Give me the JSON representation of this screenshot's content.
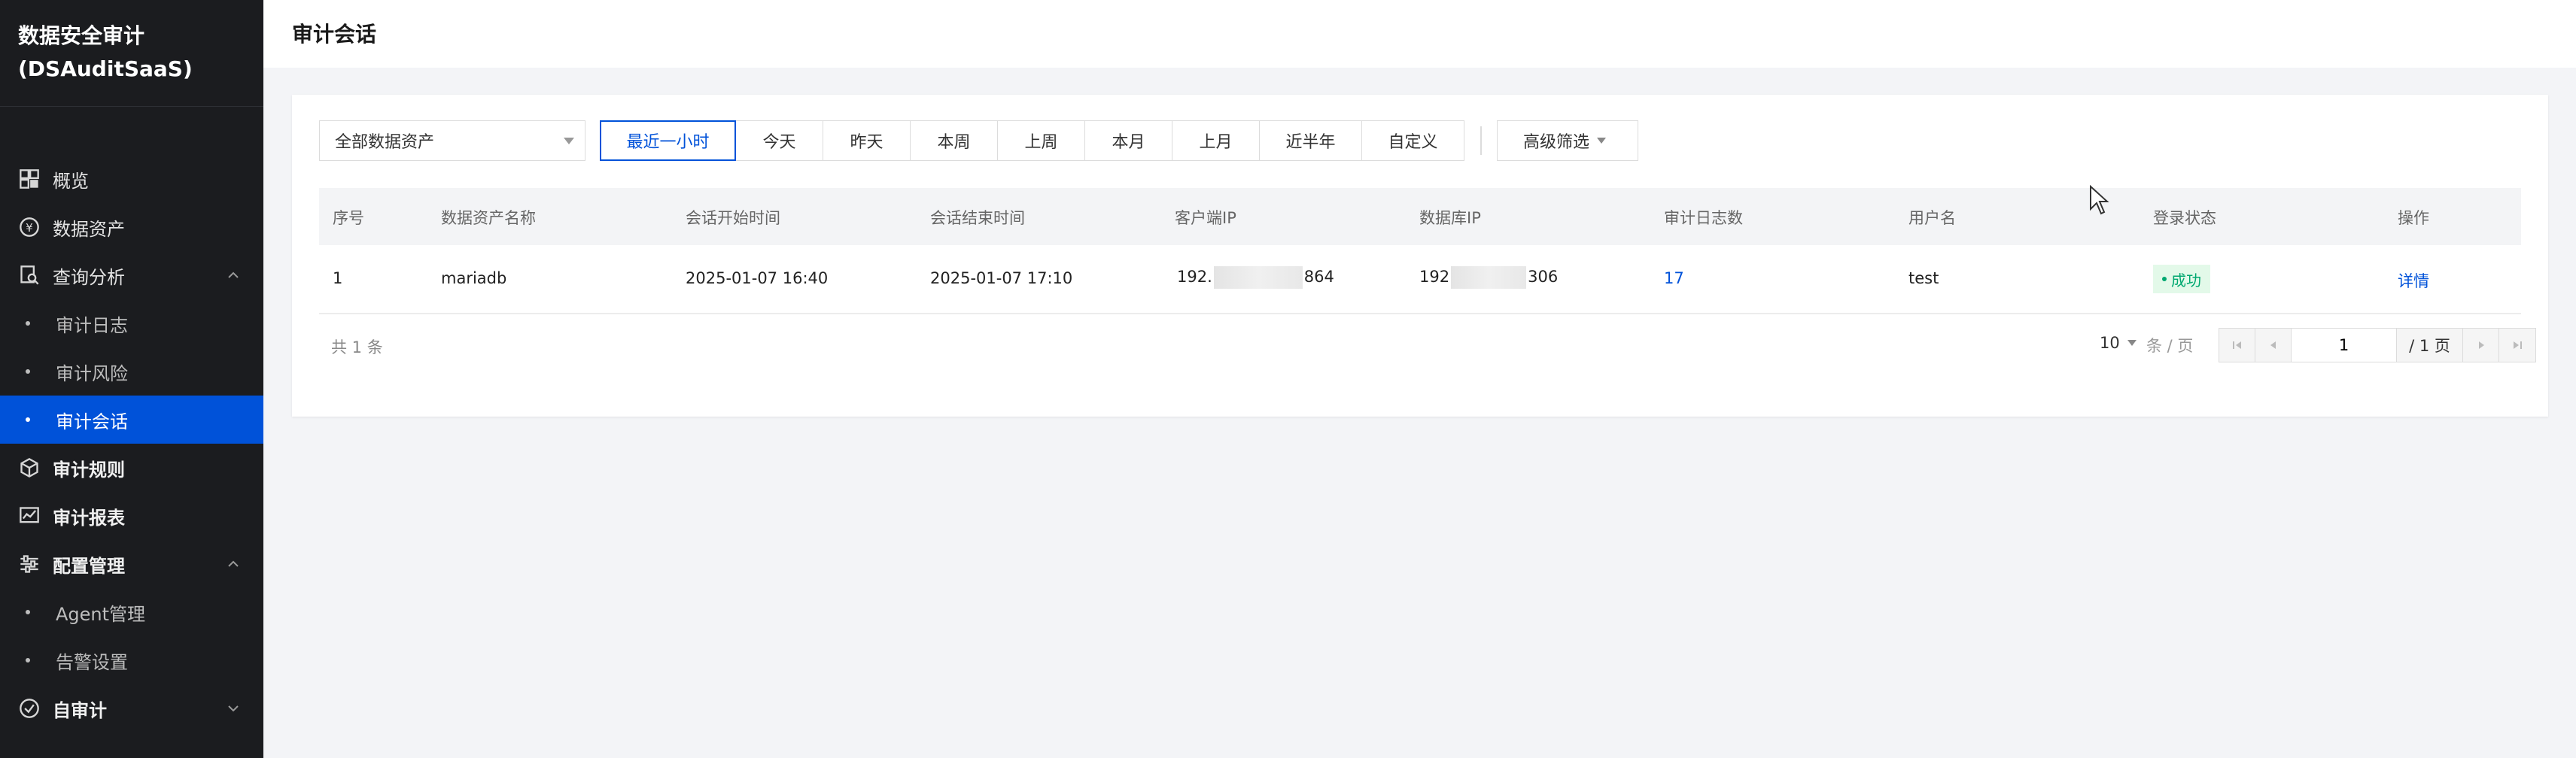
{
  "sidebar": {
    "brand_line1": "数据安全审计",
    "brand_line2": "(DSAuditSaaS)",
    "items": [
      {
        "label": "概览",
        "icon": "dashboard-icon"
      },
      {
        "label": "数据资产",
        "icon": "asset-icon"
      },
      {
        "label": "查询分析",
        "icon": "query-icon"
      },
      {
        "label": "审计日志"
      },
      {
        "label": "审计风险"
      },
      {
        "label": "审计会话"
      },
      {
        "label": "审计规则",
        "icon": "cube-icon"
      },
      {
        "label": "审计报表",
        "icon": "report-chart-icon"
      },
      {
        "label": "配置管理",
        "icon": "settings-sliders-icon"
      },
      {
        "label": "Agent管理"
      },
      {
        "label": "告警设置"
      },
      {
        "label": "自审计",
        "icon": "check-circle-icon"
      }
    ]
  },
  "header": {
    "title": "审计会话"
  },
  "filters": {
    "asset_select": "全部数据资产",
    "time_ranges": [
      "最近一小时",
      "今天",
      "昨天",
      "本周",
      "上周",
      "本月",
      "上月",
      "近半年",
      "自定义"
    ],
    "active_time_range": "最近一小时",
    "advanced_label": "高级筛选"
  },
  "table": {
    "columns": [
      "序号",
      "数据资产名称",
      "会话开始时间",
      "会话结束时间",
      "客户端IP",
      "数据库IP",
      "审计日志数",
      "用户名",
      "登录状态",
      "操作"
    ],
    "rows": [
      {
        "index": "1",
        "asset": "mariadb",
        "start": "2025-01-07 16:40",
        "end": "2025-01-07 17:10",
        "client_ip_prefix": "192.",
        "client_ip_suffix": "864",
        "db_ip_prefix": "192",
        "db_ip_suffix": "306",
        "log_count": "17",
        "username": "test",
        "status": "成功",
        "action": "详情"
      }
    ]
  },
  "pagination": {
    "total": "共 1 条",
    "page_size": "10",
    "page_size_unit": "条 / 页",
    "current_page": "1",
    "total_pages": "/ 1 页"
  },
  "colors": {
    "sidebar_bg": "#1b1c1f",
    "active_blue": "#0052d9",
    "success_green": "#00a870"
  }
}
